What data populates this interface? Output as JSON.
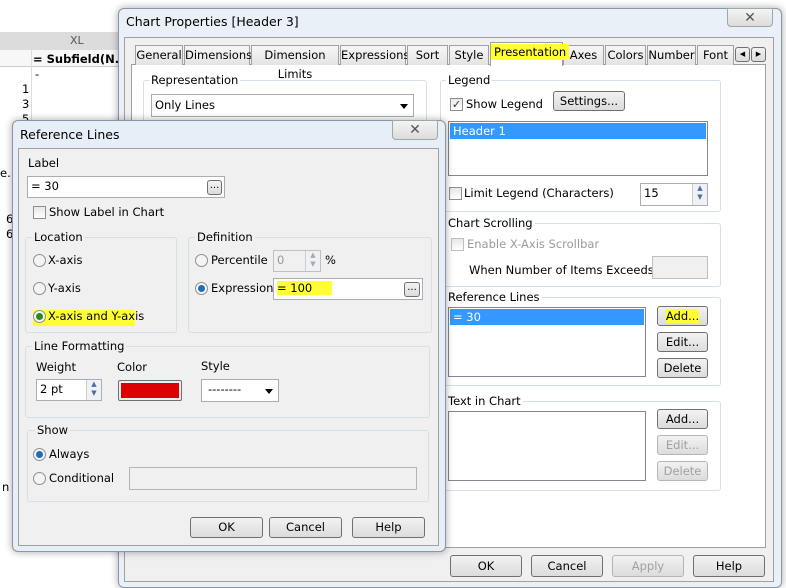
{
  "background": {
    "toolbar_label": "XL",
    "column_header": "= Subfield(N...",
    "rows": [
      "-",
      "1",
      "3",
      "5"
    ],
    "partial_texts": [
      "e..",
      "6",
      "6",
      "n"
    ]
  },
  "chart_properties": {
    "title": "Chart Properties [Header 3]",
    "tabs": [
      "General",
      "Dimensions",
      "Dimension Limits",
      "Expressions",
      "Sort",
      "Style",
      "Presentation",
      "Axes",
      "Colors",
      "Number",
      "Font"
    ],
    "selected_tab": "Presentation",
    "representation": {
      "label": "Representation",
      "value": "Only Lines"
    },
    "legend": {
      "label": "Legend",
      "show_legend": "Show Legend",
      "show_legend_checked": true,
      "settings": "Settings...",
      "items": [
        "Header 1"
      ],
      "limit_legend": "Limit Legend (Characters)",
      "limit_value": "15"
    },
    "chart_scrolling": {
      "label": "Chart Scrolling",
      "enable": "Enable X-Axis Scrollbar",
      "when": "When Number of Items Exceeds:"
    },
    "reference_lines": {
      "label": "Reference Lines",
      "items": [
        "= 30"
      ],
      "add": "Add...",
      "edit": "Edit...",
      "delete": "Delete"
    },
    "text_in_chart": {
      "label": "Text in Chart",
      "add": "Add...",
      "edit": "Edit...",
      "delete": "Delete"
    },
    "buttons": {
      "ok": "OK",
      "cancel": "Cancel",
      "apply": "Apply",
      "help": "Help"
    }
  },
  "reference_dialog": {
    "title": "Reference Lines",
    "label_title": "Label",
    "label_value": "= 30",
    "ellipsis": "...",
    "show_label": "Show Label in Chart",
    "location": {
      "label": "Location",
      "options": [
        "X-axis",
        "Y-axis",
        "X-axis and Y-axis"
      ],
      "selected": "X-axis and Y-axis"
    },
    "definition": {
      "label": "Definition",
      "percentile": "Percentile",
      "percentile_value": "0",
      "percent_sign": "%",
      "expression": "Expression",
      "expression_value": "= 100"
    },
    "line_formatting": {
      "label": "Line Formatting",
      "weight": "Weight",
      "weight_value": "2 pt",
      "color": "Color",
      "color_value": "#dd0000",
      "style": "Style",
      "style_value": "--------"
    },
    "show": {
      "label": "Show",
      "always": "Always",
      "conditional": "Conditional"
    },
    "buttons": {
      "ok": "OK",
      "cancel": "Cancel",
      "help": "Help"
    }
  },
  "highlight_color": "#ffff33"
}
